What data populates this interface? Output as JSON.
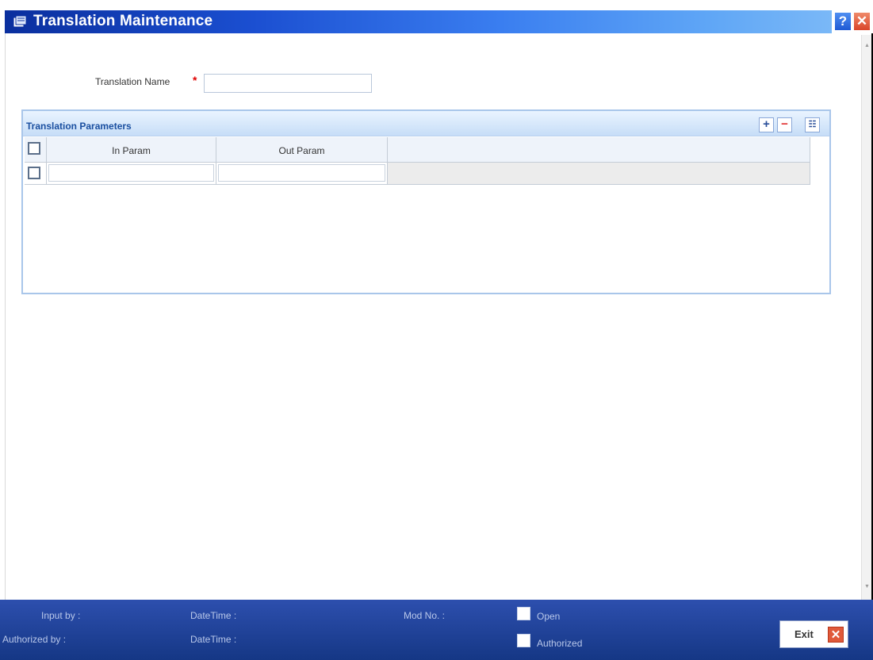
{
  "window": {
    "title": "Translation Maintenance",
    "help_glyph": "?",
    "close_glyph": "✕"
  },
  "form": {
    "translation_name_label": "Translation Name",
    "required_marker": "*",
    "translation_name_value": ""
  },
  "grid": {
    "title": "Translation Parameters",
    "add_glyph": "+",
    "delete_glyph": "−",
    "view_glyph": "☷",
    "columns": [
      "In Param",
      "Out Param"
    ],
    "rows": [
      {
        "in_param": "",
        "out_param": ""
      }
    ]
  },
  "footer": {
    "input_by_label": "Input by :",
    "authorized_by_label": "Authorized by :",
    "datetime_label_1": "DateTime :",
    "datetime_label_2": "DateTime :",
    "mod_no_label": "Mod No. :",
    "open_label": "Open",
    "authorized_label": "Authorized",
    "exit_label": "Exit",
    "exit_glyph": "✕"
  },
  "colors": {
    "title_bar": "#1b4fd1",
    "footer": "#2d4fae",
    "section_border": "#a9c6ea",
    "required": "#e00000",
    "close": "#e05a3a"
  }
}
